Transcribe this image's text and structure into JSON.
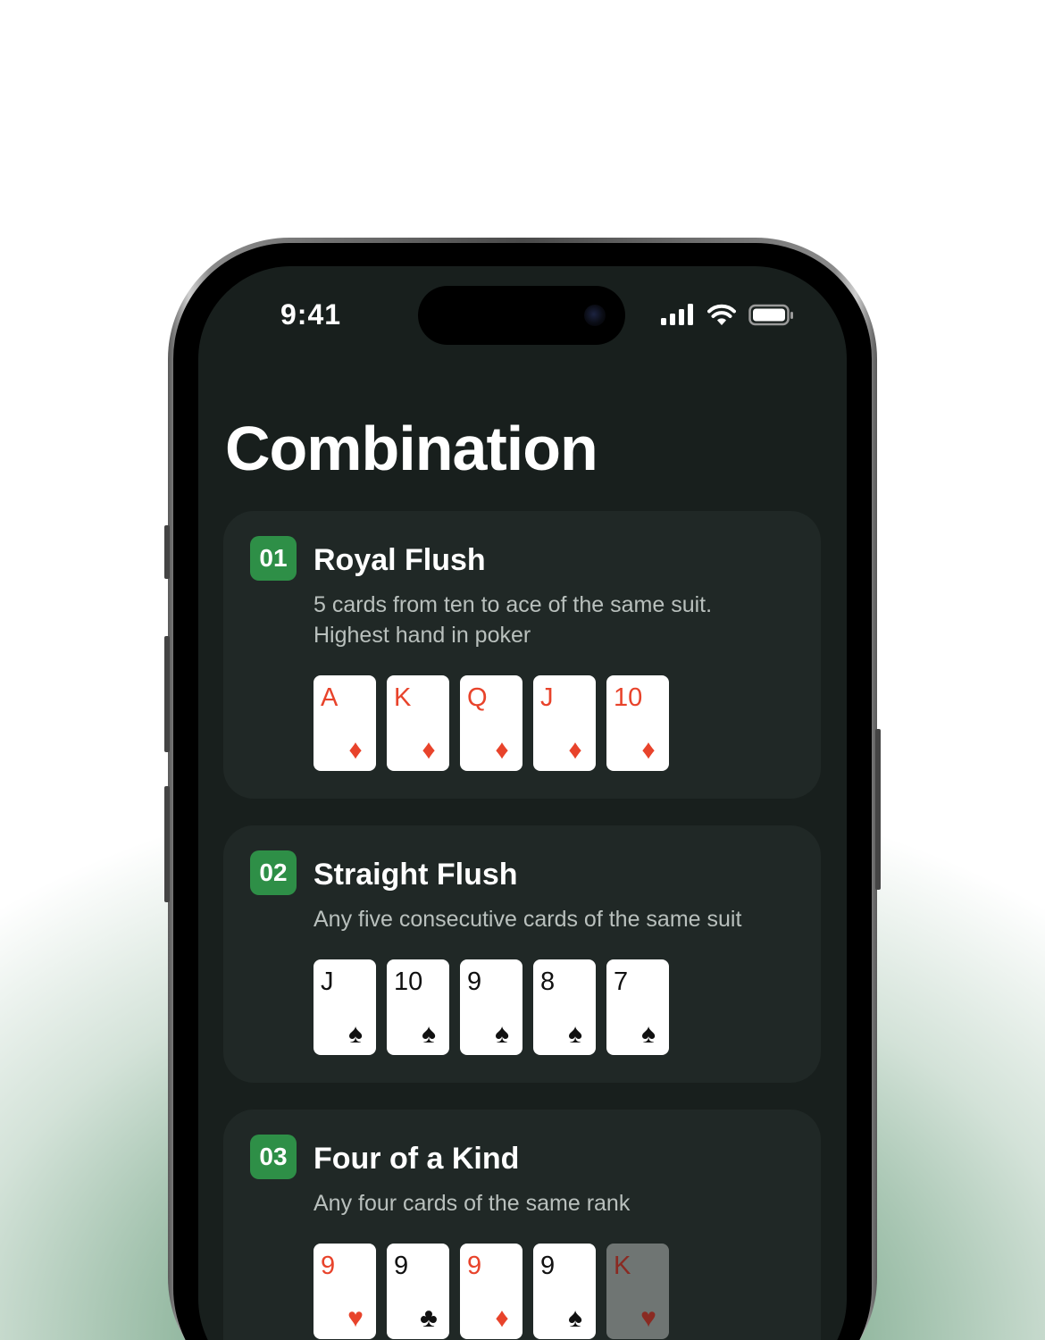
{
  "status_bar": {
    "time": "9:41"
  },
  "page": {
    "title": "Combination"
  },
  "combinations": [
    {
      "number": "01",
      "name": "Royal Flush",
      "description": "5 cards from ten to ace of the same suit. Highest hand in poker",
      "cards": [
        {
          "rank": "A",
          "suit": "♦",
          "suit_name": "diamond-icon",
          "color": "red"
        },
        {
          "rank": "K",
          "suit": "♦",
          "suit_name": "diamond-icon",
          "color": "red"
        },
        {
          "rank": "Q",
          "suit": "♦",
          "suit_name": "diamond-icon",
          "color": "red"
        },
        {
          "rank": "J",
          "suit": "♦",
          "suit_name": "diamond-icon",
          "color": "red"
        },
        {
          "rank": "10",
          "suit": "♦",
          "suit_name": "diamond-icon",
          "color": "red"
        }
      ]
    },
    {
      "number": "02",
      "name": "Straight Flush",
      "description": "Any five consecutive cards of the same suit",
      "cards": [
        {
          "rank": "J",
          "suit": "♠",
          "suit_name": "spade-icon",
          "color": "black"
        },
        {
          "rank": "10",
          "suit": "♠",
          "suit_name": "spade-icon",
          "color": "black"
        },
        {
          "rank": "9",
          "suit": "♠",
          "suit_name": "spade-icon",
          "color": "black"
        },
        {
          "rank": "8",
          "suit": "♠",
          "suit_name": "spade-icon",
          "color": "black"
        },
        {
          "rank": "7",
          "suit": "♠",
          "suit_name": "spade-icon",
          "color": "black"
        }
      ]
    },
    {
      "number": "03",
      "name": "Four of a Kind",
      "description": "Any four cards of the same rank",
      "cards": [
        {
          "rank": "9",
          "suit": "♥",
          "suit_name": "heart-icon",
          "color": "red"
        },
        {
          "rank": "9",
          "suit": "♣",
          "suit_name": "club-icon",
          "color": "black"
        },
        {
          "rank": "9",
          "suit": "♦",
          "suit_name": "diamond-icon",
          "color": "red"
        },
        {
          "rank": "9",
          "suit": "♠",
          "suit_name": "spade-icon",
          "color": "black"
        },
        {
          "rank": "K",
          "suit": "♥",
          "suit_name": "heart-icon",
          "color": "dim"
        }
      ]
    }
  ],
  "colors": {
    "accent": "#2e8f47",
    "card_red": "#e8432b",
    "screen_bg": "#181f1d",
    "panel_bg": "#202826"
  }
}
